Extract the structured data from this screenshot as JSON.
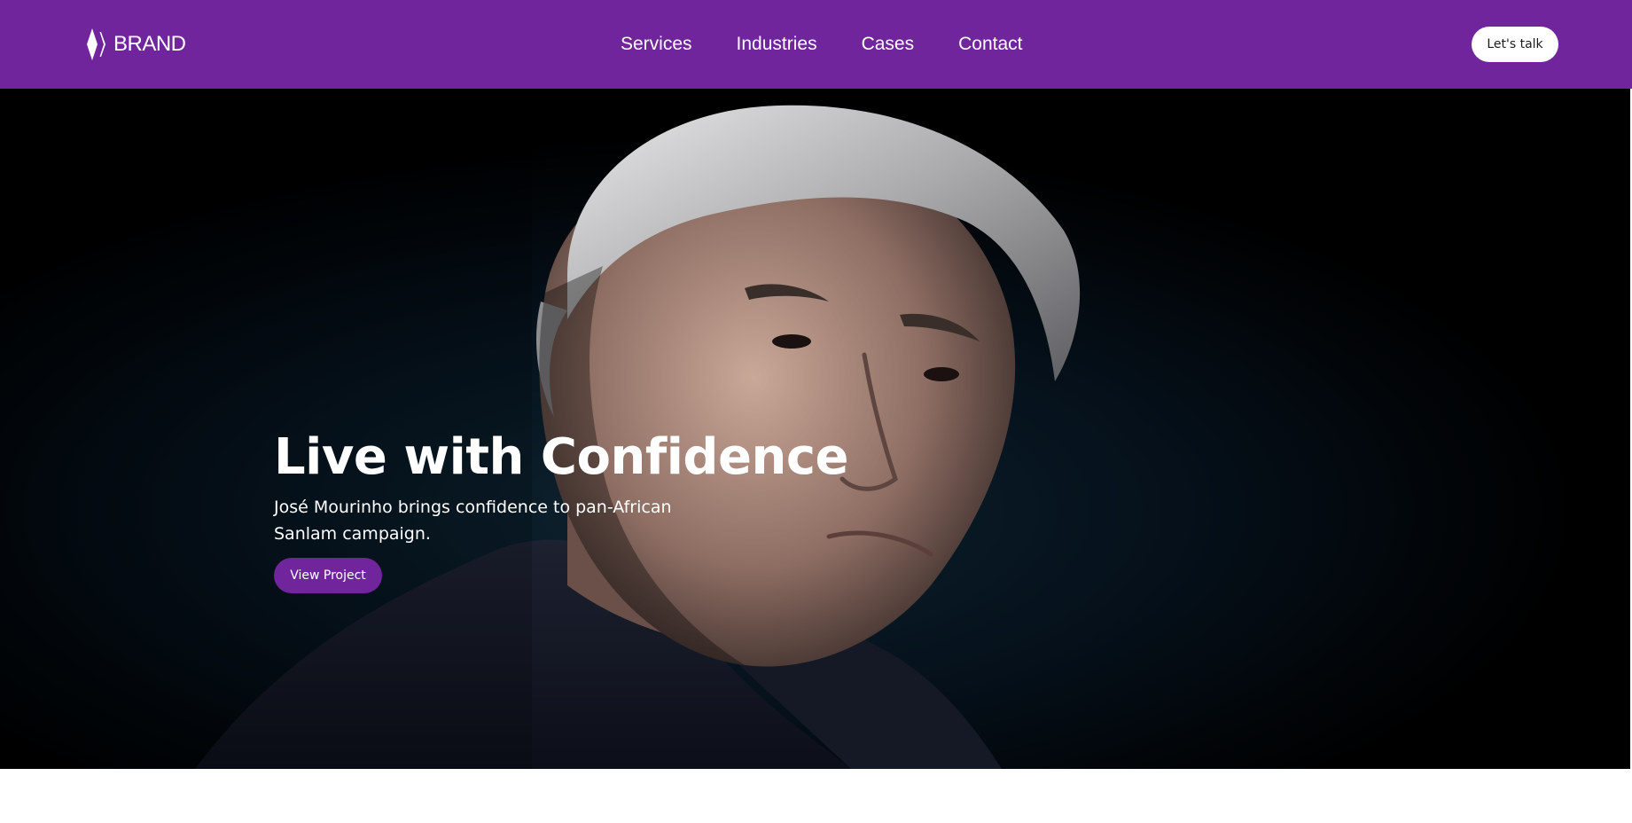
{
  "header": {
    "logo_text": "BRAND",
    "nav": [
      "Services",
      "Industries",
      "Cases",
      "Contact"
    ],
    "cta_label": "Let's talk",
    "background_color": "#70259c"
  },
  "hero": {
    "title": "Live with Confidence",
    "subtitle": "José Mourinho brings confidence to pan-African Sanlam campaign.",
    "button_label": "View Project",
    "button_color": "#70259c",
    "image": "portrait-photo"
  }
}
